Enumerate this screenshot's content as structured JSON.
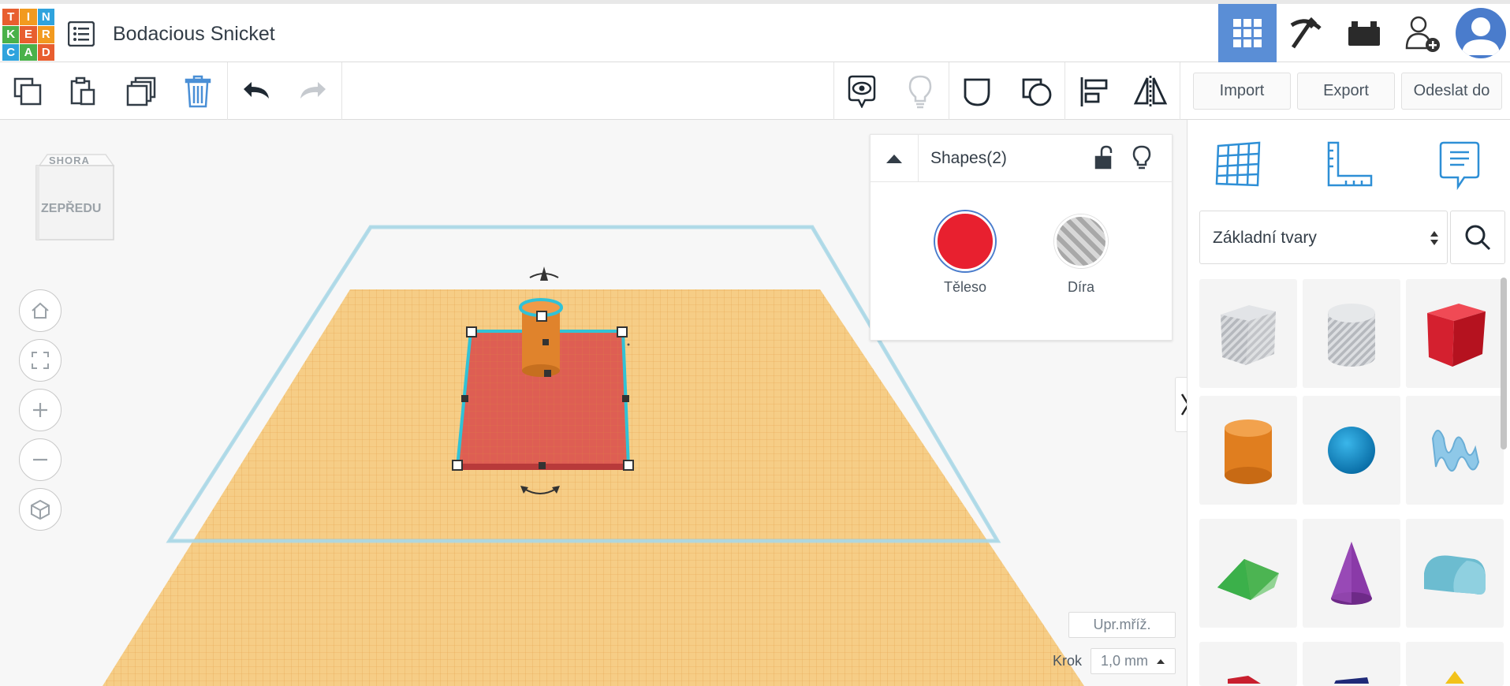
{
  "app": {
    "logo_letters": [
      "T",
      "I",
      "N",
      "K",
      "E",
      "R",
      "C",
      "A",
      "D"
    ],
    "logo_colors": [
      "#e85e2f",
      "#f29a1f",
      "#2fa3dd",
      "#4ab14a",
      "#e85e2f",
      "#f29a1f",
      "#2fa3dd",
      "#4ab14a",
      "#e85e2f"
    ],
    "project_title": "Bodacious Snicket"
  },
  "topbar": {
    "icons": [
      "grid-view-icon",
      "pickaxe-icon",
      "bricks-icon",
      "add-user-icon",
      "avatar"
    ],
    "active_color": "#5a8ed6"
  },
  "toolbar": {
    "left_icons": [
      "copy-icon",
      "paste-icon",
      "duplicate-icon",
      "delete-icon",
      "undo-icon",
      "redo-icon"
    ],
    "right_icons": [
      "show-all-icon",
      "hint-bulb-icon",
      "group-icon",
      "ungroup-icon",
      "align-icon",
      "mirror-icon"
    ],
    "import_label": "Import",
    "export_label": "Export",
    "send_label": "Odeslat do"
  },
  "viewcube": {
    "top_label": "SHORA",
    "front_label": "ZEPŘEDU"
  },
  "nav_controls": [
    "home-icon",
    "fit-icon",
    "zoom-in-icon",
    "zoom-out-icon",
    "perspective-icon"
  ],
  "inspector": {
    "title": "Shapes(2)",
    "solid_label": "Těleso",
    "hole_label": "Díra",
    "solid_color": "#e8202f"
  },
  "right_panel": {
    "tabs": [
      "workplane-icon",
      "ruler-icon",
      "notes-icon"
    ],
    "category_label": "Základní tvary",
    "shapes": [
      "box-hole",
      "cylinder-hole",
      "box",
      "cylinder",
      "sphere",
      "scribble",
      "roof",
      "cone",
      "round-roof"
    ]
  },
  "bottom": {
    "edit_grid_label": "Upr.mříž.",
    "snap_label": "Krok",
    "snap_value": "1,0 mm"
  }
}
